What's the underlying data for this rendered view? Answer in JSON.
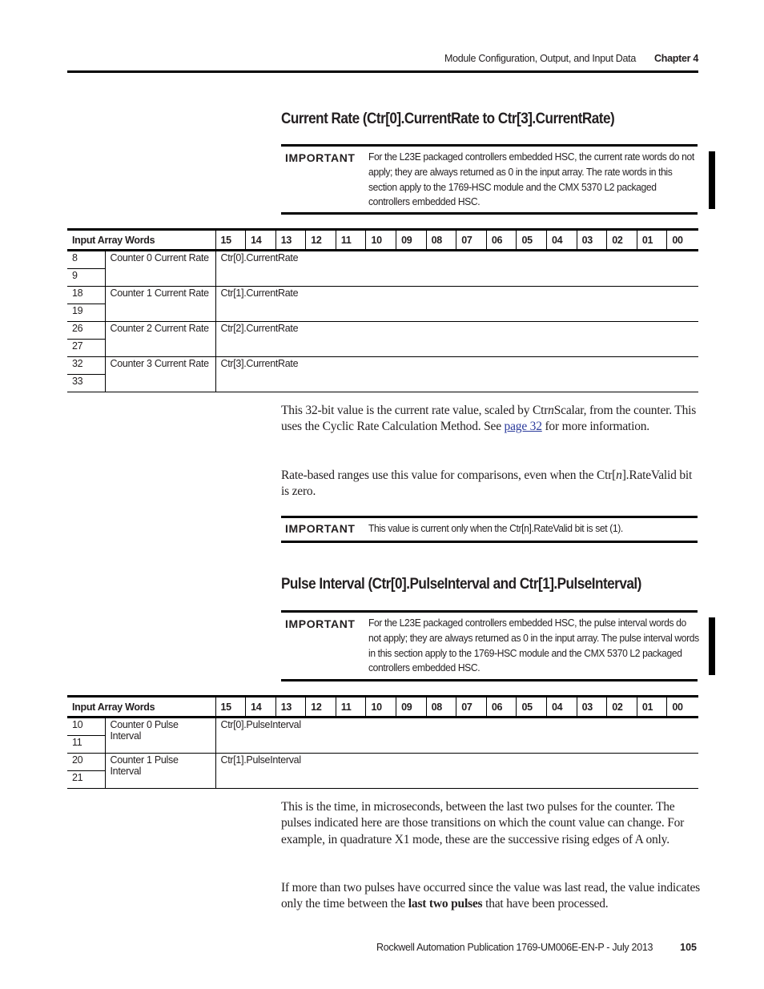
{
  "header": {
    "section_title": "Module Configuration, Output, and Input Data",
    "chapter": "Chapter 4"
  },
  "sections": [
    {
      "title": "Current Rate (Ctr[0].CurrentRate to Ctr[3].CurrentRate)",
      "important": {
        "label": "IMPORTANT",
        "text": "For the L23E packaged controllers embedded HSC, the current rate words do not apply; they are always returned as 0 in the input array. The rate words in this section apply to the 1769-HSC module and the CMX 5370 L2 packaged controllers embedded HSC."
      },
      "table": {
        "header": [
          "Input Array Words",
          "15",
          "14",
          "13",
          "12",
          "11",
          "10",
          "09",
          "08",
          "07",
          "06",
          "05",
          "04",
          "03",
          "02",
          "01",
          "00"
        ],
        "rows": [
          {
            "words": [
              "8",
              "9"
            ],
            "name": "Counter 0 Current Rate",
            "tag": "Ctr[0].CurrentRate"
          },
          {
            "words": [
              "18",
              "19"
            ],
            "name": "Counter 1 Current Rate",
            "tag": "Ctr[1].CurrentRate"
          },
          {
            "words": [
              "26",
              "27"
            ],
            "name": "Counter 2 Current Rate",
            "tag": "Ctr[2].CurrentRate"
          },
          {
            "words": [
              "32",
              "33"
            ],
            "name": "Counter 3 Current Rate",
            "tag": "Ctr[3].CurrentRate"
          }
        ]
      },
      "para1": {
        "part1": "This 32-bit value is the current rate value, scaled by Ctr",
        "italic": "n",
        "part2": "Scalar, from the counter. This uses the Cyclic Rate Calculation Method. See ",
        "link": "page 32",
        "part3": " for more information."
      },
      "para2": {
        "part1": "Rate-based ranges use this value for comparisons, even when the Ctr[",
        "italic": "n",
        "part2": "].RateValid bit is zero."
      },
      "important2": {
        "label": "IMPORTANT",
        "text": "This value is current only when the Ctr[n].RateValid bit is set (1)."
      }
    },
    {
      "title": "Pulse Interval (Ctr[0].PulseInterval and Ctr[1].PulseInterval)",
      "important": {
        "label": "IMPORTANT",
        "text": "For the L23E packaged controllers embedded HSC, the pulse interval words do not apply; they are always returned as 0 in the input array. The pulse interval words in this section apply to the 1769-HSC module and the CMX 5370 L2 packaged controllers embedded HSC."
      },
      "table": {
        "header": [
          "Input Array Words",
          "15",
          "14",
          "13",
          "12",
          "11",
          "10",
          "09",
          "08",
          "07",
          "06",
          "05",
          "04",
          "03",
          "02",
          "01",
          "00"
        ],
        "rows": [
          {
            "words": [
              "10",
              "11"
            ],
            "name": "Counter 0 Pulse Interval",
            "tag": "Ctr[0].PulseInterval"
          },
          {
            "words": [
              "20",
              "21"
            ],
            "name": "Counter 1 Pulse Interval",
            "tag": "Ctr[1].PulseInterval"
          }
        ]
      },
      "para1": "This is the time, in microseconds, between the last two pulses for the counter. The pulses indicated here are those transitions on which the count value can change. For example, in quadrature X1 mode, these are the successive rising edges of A only.",
      "para2": {
        "part1": "If more than two pulses have occurred since the value was last read, the value indicates only the time between the ",
        "bold": "last two pulses",
        "part2": " that have been processed."
      }
    }
  ],
  "footer": {
    "publication": "Rockwell Automation Publication 1769-UM006E-EN-P - July 2013",
    "page_number": "105"
  }
}
